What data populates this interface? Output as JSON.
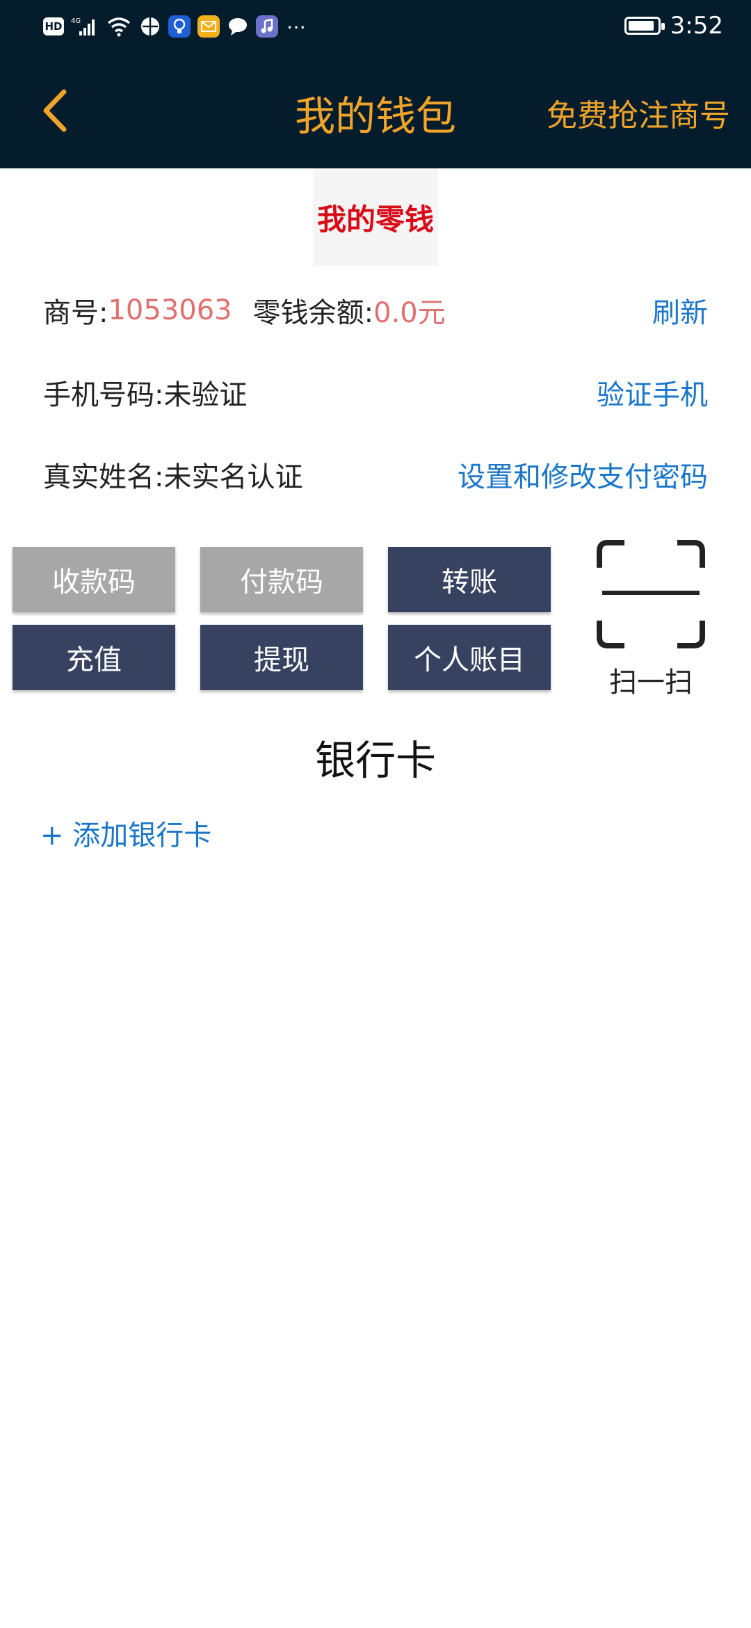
{
  "status_bar": {
    "icons": [
      "hd-icon",
      "signal-4g-icon",
      "wifi-icon",
      "vpn-icon",
      "bulb-app-icon",
      "mail-app-icon",
      "chat-icon",
      "music-app-icon",
      "more-icon"
    ],
    "time": "3:52",
    "battery_level": 0.9
  },
  "nav": {
    "title": "我的钱包",
    "action": "免费抢注商号"
  },
  "section": {
    "tab": "我的零钱"
  },
  "info": {
    "merchant_label": "商号:",
    "merchant_value": "1053063",
    "balance_label": "零钱余额:",
    "balance_value": "0.0元",
    "refresh": "刷新",
    "phone_label": "手机号码:",
    "phone_value": "未验证",
    "verify_phone": "验证手机",
    "name_label": "真实姓名:",
    "name_value": "未实名认证",
    "set_password": "设置和修改支付密码"
  },
  "buttons": {
    "receive": "收款码",
    "pay": "付款码",
    "transfer": "转账",
    "recharge": "充值",
    "withdraw": "提现",
    "records": "个人账目"
  },
  "scan": {
    "label": "扫一扫"
  },
  "bank": {
    "title": "银行卡",
    "add": "+ 添加银行卡"
  },
  "colors": {
    "nav_bg": "#051c2c",
    "accent_orange": "#f0a52a",
    "tab_red": "#d80c18",
    "value_red": "#e07070",
    "link_blue": "#1a76c9",
    "button_grey": "#a7a7a7",
    "button_navy": "#364260"
  }
}
